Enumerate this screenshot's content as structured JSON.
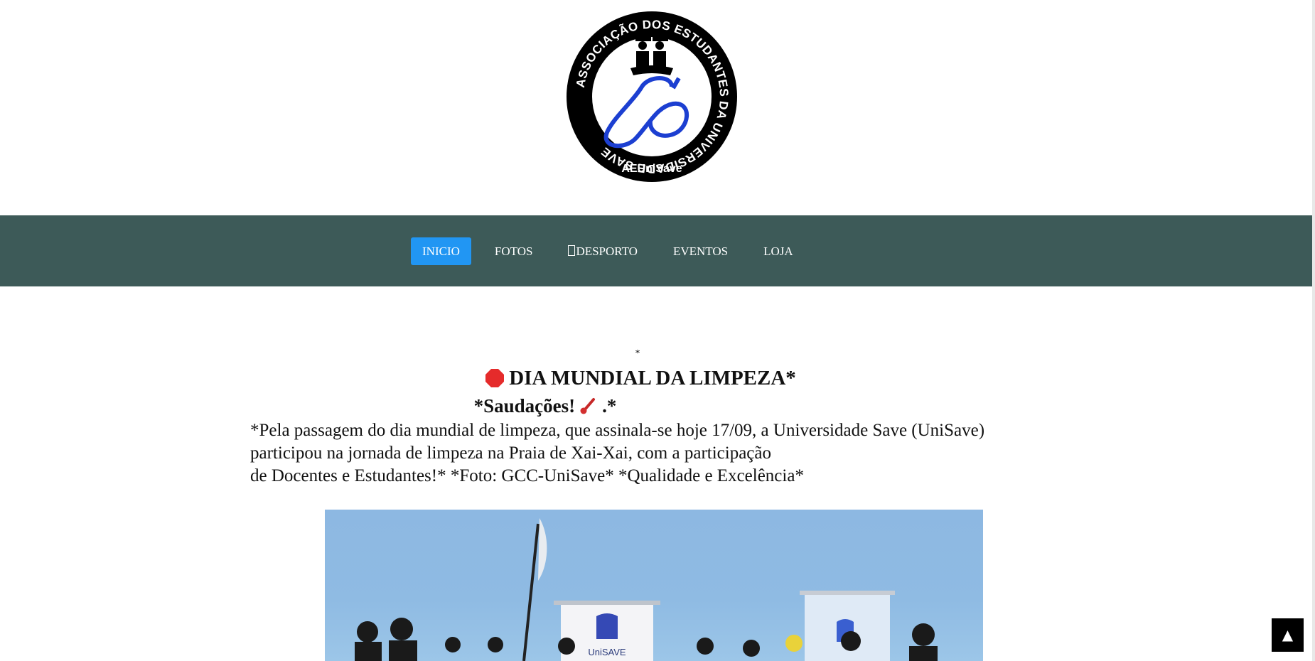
{
  "header": {
    "logo": {
      "ring_text": "ASSOCIAÇÃO DOS ESTUDANTES DA UNIVERSIDADE SAVE",
      "bottom_text": "AEUniSave",
      "icon": "graduates-logo-icon"
    }
  },
  "nav": {
    "items": [
      {
        "label": "INICIO",
        "active": true
      },
      {
        "label": "FOTOS",
        "active": false
      },
      {
        "label": "DESPORTO",
        "active": false,
        "icon": "missing-glyph-box"
      },
      {
        "label": "EVENTOS",
        "active": false
      },
      {
        "label": "LOJA",
        "active": false
      }
    ],
    "colors": {
      "background": "#3d5a58",
      "active": "#2196f3"
    }
  },
  "post": {
    "star": "*",
    "title": "DIA MUNDIAL DA LIMPEZA*",
    "title_icon": "stop-sign-icon",
    "greeting_prefix": "*Saudações!",
    "greeting_suffix": ".*",
    "greeting_icon": "thermometer-icon",
    "body_lines": [
      "*Pela passagem do dia mundial de limpeza, que assinala-se hoje 17/09, a Universidade Save (UniSave)",
      "participou na jornada de limpeza na Praia de Xai-Xai, com a participação",
      "de Docentes e Estudantes!* *Foto: GCC-UniSave* *Qualidade e Excelência*"
    ],
    "photo": {
      "banner_left_text": "UniSAVE",
      "subject": "beach-cleanup-group-photo"
    }
  },
  "back_to_top": {
    "label": "▲"
  }
}
